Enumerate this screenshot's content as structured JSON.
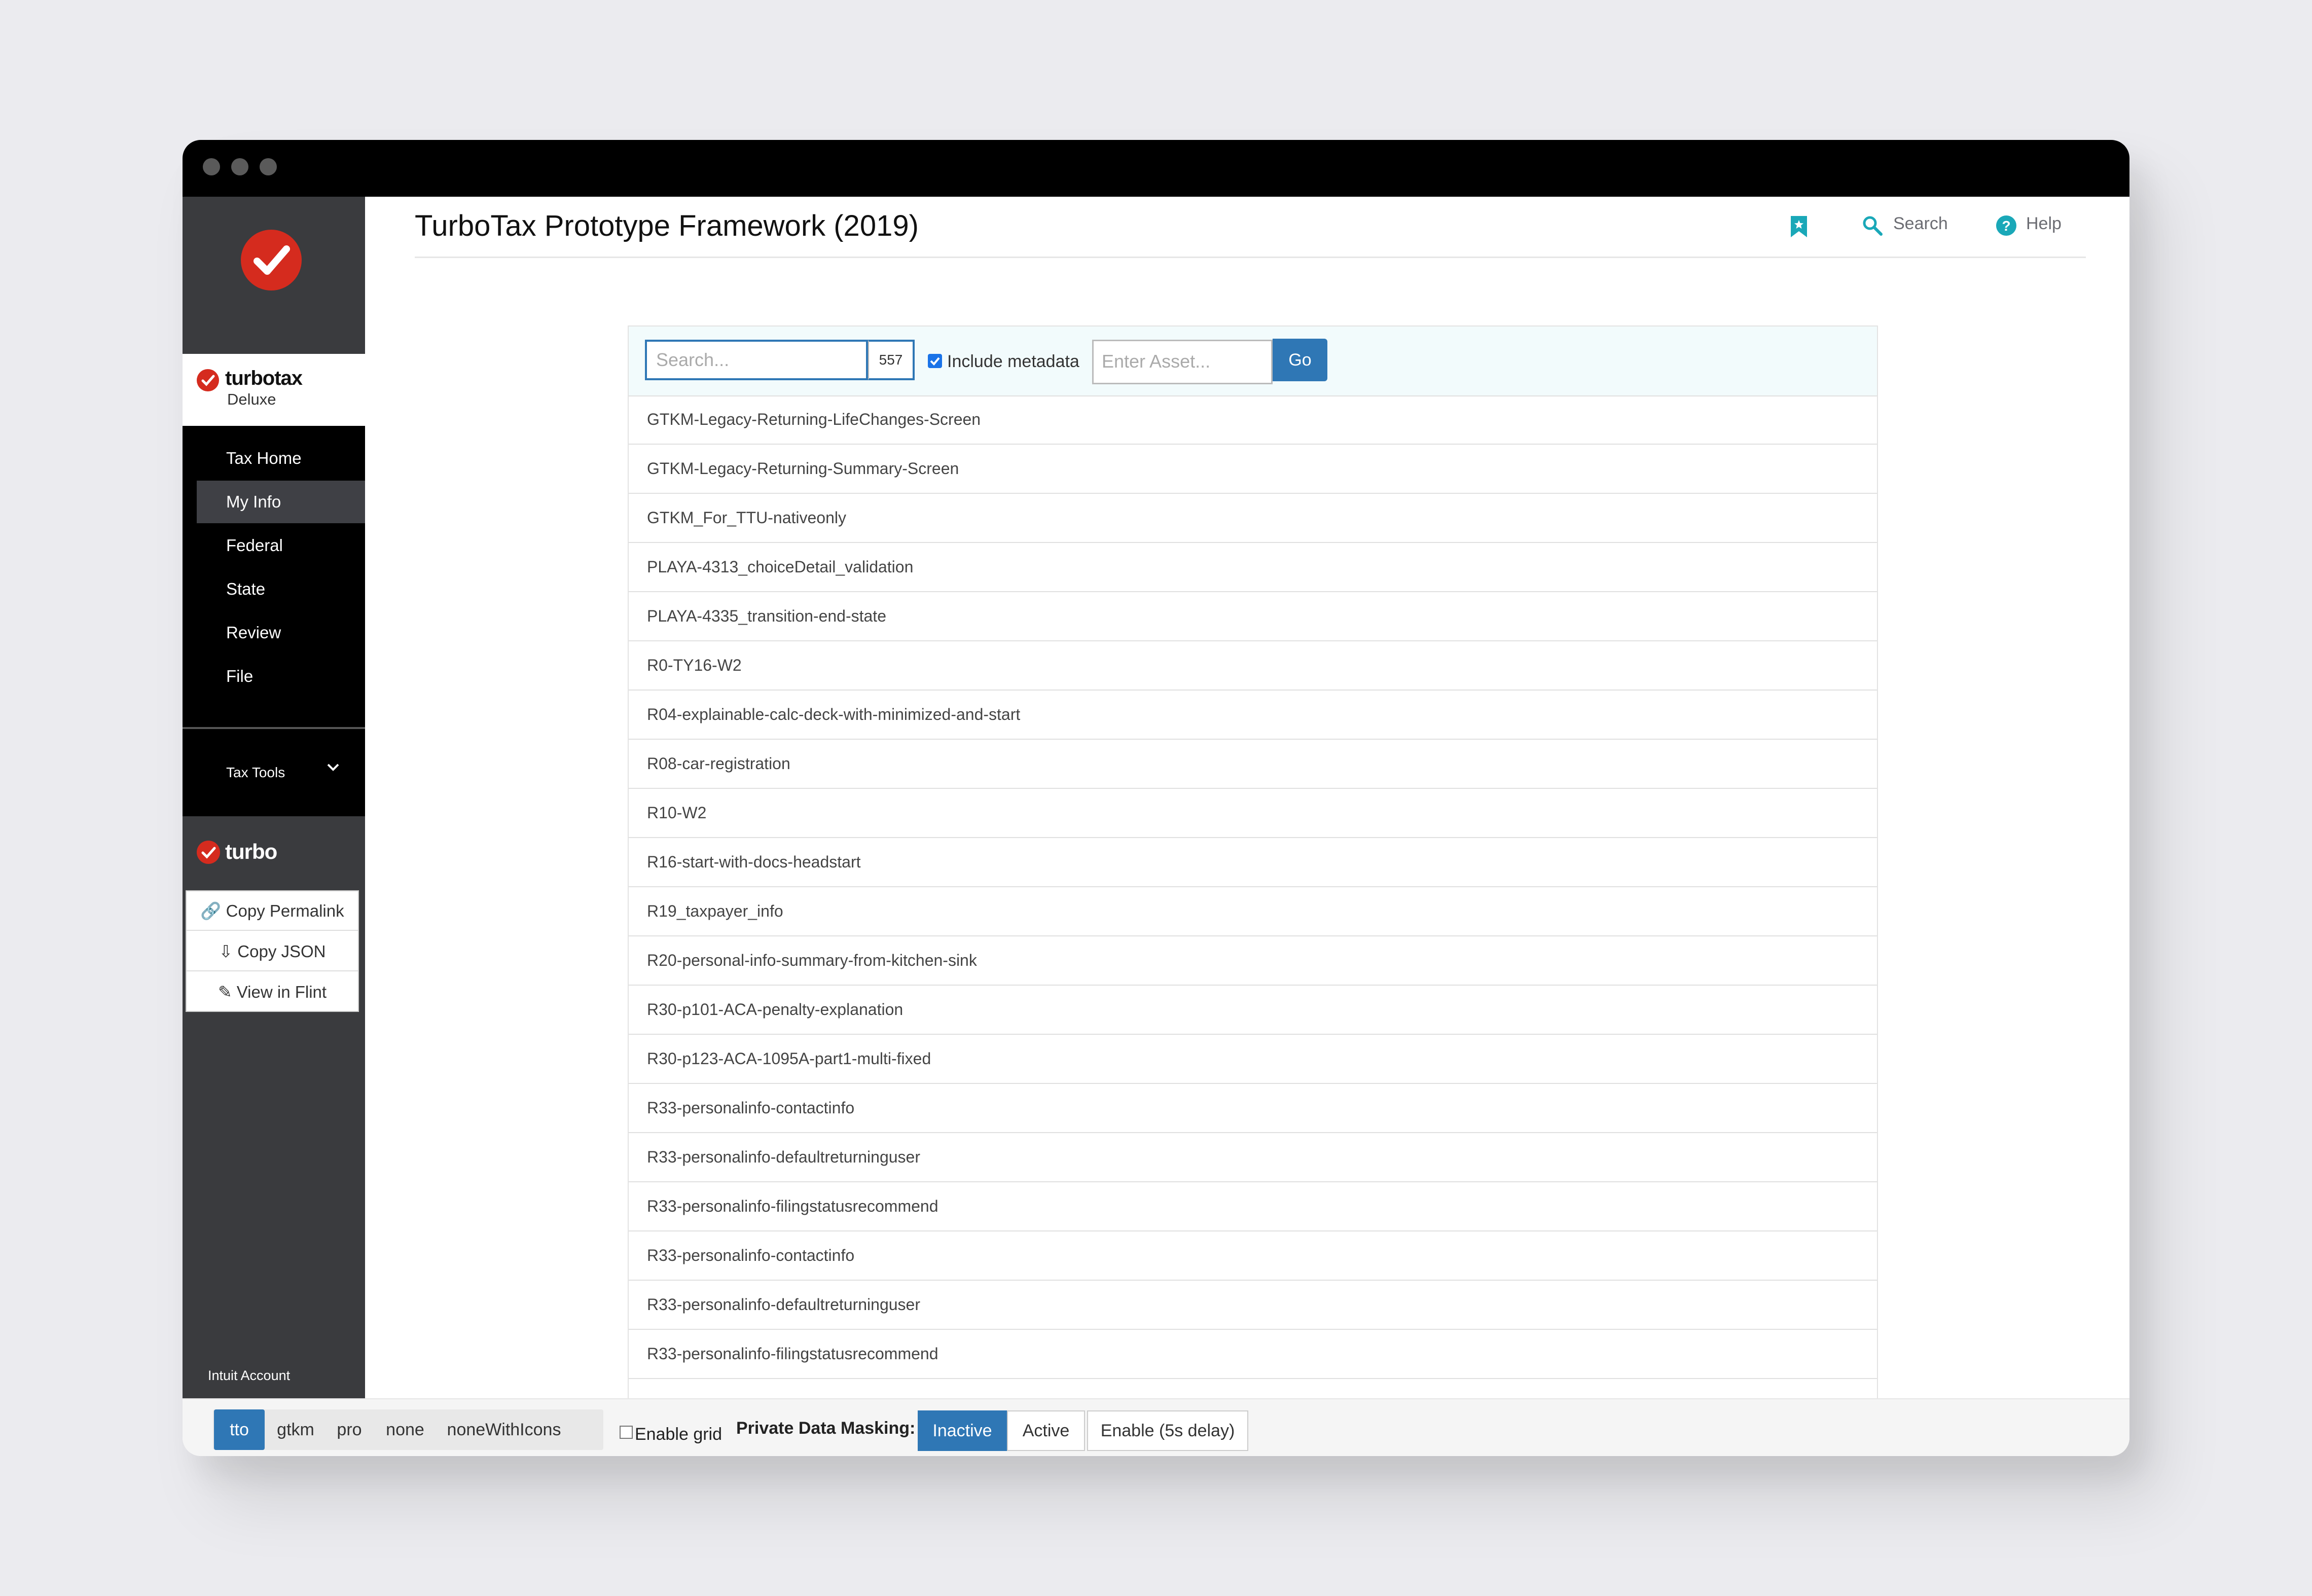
{
  "app": {
    "brand": {
      "name": "turbotax",
      "edition": "Deluxe"
    },
    "title": "TurboTax Prototype Framework (2019)"
  },
  "header": {
    "search_label": "Search",
    "help_label": "Help"
  },
  "sidebar": {
    "nav": [
      {
        "label": "Tax Home"
      },
      {
        "label": "My Info",
        "active": true
      },
      {
        "label": "Federal"
      },
      {
        "label": "State"
      },
      {
        "label": "Review"
      },
      {
        "label": "File"
      }
    ],
    "tools_label": "Tax Tools",
    "turbo_label": "turbo",
    "tool_menu": [
      {
        "label": "Copy Permalink",
        "icon": "link-icon"
      },
      {
        "label": "Copy JSON",
        "icon": "download-icon"
      },
      {
        "label": "View in Flint",
        "icon": "pencil-icon"
      }
    ],
    "account_label": "Intuit Account"
  },
  "search": {
    "placeholder": "Search...",
    "count": "557",
    "include_metadata_label": "Include metadata",
    "include_metadata_checked": true,
    "asset_placeholder": "Enter Asset...",
    "go_label": "Go"
  },
  "results": [
    "GTKM-Legacy-Returning-LifeChanges-Screen",
    "GTKM-Legacy-Returning-Summary-Screen",
    "GTKM_For_TTU-nativeonly",
    "PLAYA-4313_choiceDetail_validation",
    "PLAYA-4335_transition-end-state",
    "R0-TY16-W2",
    "R04-explainable-calc-deck-with-minimized-and-start",
    "R08-car-registration",
    "R10-W2",
    "R16-start-with-docs-headstart",
    "R19_taxpayer_info",
    "R20-personal-info-summary-from-kitchen-sink",
    "R30-p101-ACA-penalty-explanation",
    "R30-p123-ACA-1095A-part1-multi-fixed",
    "R33-personalinfo-contactinfo",
    "R33-personalinfo-defaultreturninguser",
    "R33-personalinfo-filingstatusrecommend",
    "R33-personalinfo-contactinfo",
    "R33-personalinfo-defaultreturninguser",
    "R33-personalinfo-filingstatusrecommend"
  ],
  "footer": {
    "env_buttons": [
      "tto",
      "gtkm",
      "pro",
      "none",
      "noneWithIcons"
    ],
    "env_active": "tto",
    "enable_grid_label": "Enable grid",
    "masking_label": "Private Data Masking:",
    "masking_buttons": [
      "Inactive",
      "Active",
      "Enable (5s delay)"
    ],
    "masking_active": "Inactive"
  },
  "colors": {
    "accent": "#2f77b5",
    "brand_red": "#d52b1e",
    "teal": "#1aa8b8"
  }
}
